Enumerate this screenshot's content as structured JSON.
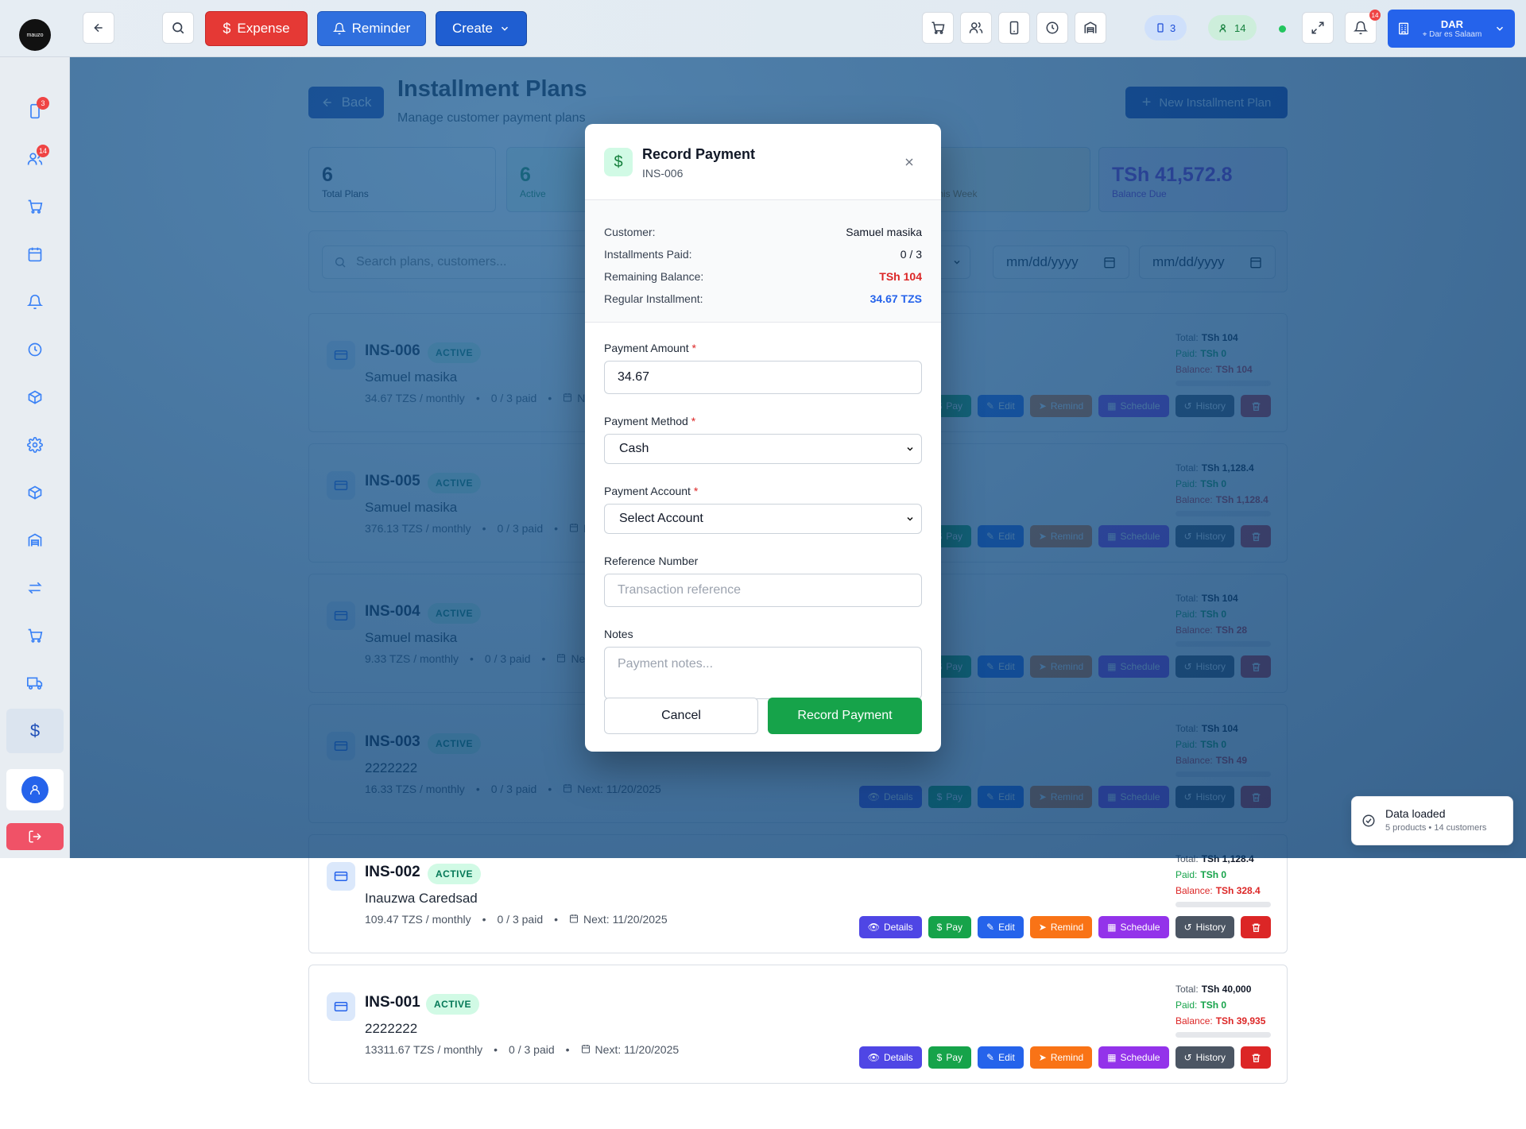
{
  "topbar": {
    "logo_text": "mauzo",
    "expense_label": "Expense",
    "reminder_label": "Reminder",
    "create_label": "Create",
    "devices_count": "3",
    "customers_count": "14",
    "notification_count": "14",
    "branch_code": "DAR",
    "branch_location": "Dar es Salaam"
  },
  "sidebar": {
    "orders_badge": "3",
    "customers_badge": "14"
  },
  "page": {
    "back_label": "Back",
    "title": "Installment Plans",
    "subtitle": "Manage customer payment plans",
    "new_plan_label": "New Installment Plan"
  },
  "stats": {
    "total_plans_value": "6",
    "total_plans_label": "Total Plans",
    "active_value": "6",
    "active_label": "Active",
    "due_week_label": "This Week",
    "balance_value": "TSh 41,572.8",
    "balance_label": "Balance Due"
  },
  "filters": {
    "search_placeholder": "Search plans, customers...",
    "select_fragment": "s",
    "date_from": "mm/dd/yyyy",
    "date_to": "mm/dd/yyyy"
  },
  "labels": {
    "total": "Total:",
    "paid": "Paid:",
    "balance": "Balance:",
    "details": "Details",
    "pay": "Pay",
    "edit": "Edit",
    "remind": "Remind",
    "schedule": "Schedule",
    "history": "History"
  },
  "plans": [
    {
      "id": "INS-006",
      "status": "ACTIVE",
      "customer": "Samuel masika",
      "rate": "34.67 TZS / monthly",
      "paid_count": "0 / 3 paid",
      "next": "Next: 11/20/2025",
      "total": "TSh 104",
      "paid": "TSh 0",
      "balance": "TSh 104"
    },
    {
      "id": "INS-005",
      "status": "ACTIVE",
      "customer": "Samuel masika",
      "rate": "376.13 TZS / monthly",
      "paid_count": "0 / 3 paid",
      "next": "Next: 11/20/2025",
      "total": "TSh 1,128.4",
      "paid": "TSh 0",
      "balance": "TSh 1,128.4"
    },
    {
      "id": "INS-004",
      "status": "ACTIVE",
      "customer": "Samuel masika",
      "rate": "9.33 TZS / monthly",
      "paid_count": "0 / 3 paid",
      "next": "Next: 11/20/2025",
      "total": "TSh 104",
      "paid": "TSh 0",
      "balance": "TSh 28"
    },
    {
      "id": "INS-003",
      "status": "ACTIVE",
      "customer": "2222222",
      "rate": "16.33 TZS / monthly",
      "paid_count": "0 / 3 paid",
      "next": "Next: 11/20/2025",
      "total": "TSh 104",
      "paid": "TSh 0",
      "balance": "TSh 49"
    },
    {
      "id": "INS-002",
      "status": "ACTIVE",
      "customer": "Inauzwa Caredsad",
      "rate": "109.47 TZS / monthly",
      "paid_count": "0 / 3 paid",
      "next": "Next: 11/20/2025",
      "total": "TSh 1,128.4",
      "paid": "TSh 0",
      "balance": "TSh 328.4"
    },
    {
      "id": "INS-001",
      "status": "ACTIVE",
      "customer": "2222222",
      "rate": "13311.67 TZS / monthly",
      "paid_count": "0 / 3 paid",
      "next": "Next: 11/20/2025",
      "total": "TSh 40,000",
      "paid": "TSh 0",
      "balance": "TSh 39,935"
    }
  ],
  "modal": {
    "title": "Record Payment",
    "plan_id": "INS-006",
    "customer_label": "Customer:",
    "customer_value": "Samuel masika",
    "installments_label": "Installments Paid:",
    "installments_value": "0 / 3",
    "remaining_label": "Remaining Balance:",
    "remaining_value": "TSh 104",
    "regular_label": "Regular Installment:",
    "regular_value": "34.67 TZS",
    "amount_label": "Payment Amount",
    "amount_value": "34.67",
    "method_label": "Payment Method",
    "method_value": "Cash",
    "account_label": "Payment Account",
    "account_value": "Select Account",
    "reference_label": "Reference Number",
    "reference_placeholder": "Transaction reference",
    "notes_label": "Notes",
    "notes_placeholder": "Payment notes...",
    "required_mark": "*",
    "cancel_label": "Cancel",
    "submit_label": "Record Payment"
  },
  "toast": {
    "title": "Data loaded",
    "detail": "5 products • 14 customers"
  },
  "colors": {
    "accent_green": "#16a34a",
    "accent_blue": "#2563eb",
    "danger": "#dc2626",
    "overlay": "#05468299"
  }
}
